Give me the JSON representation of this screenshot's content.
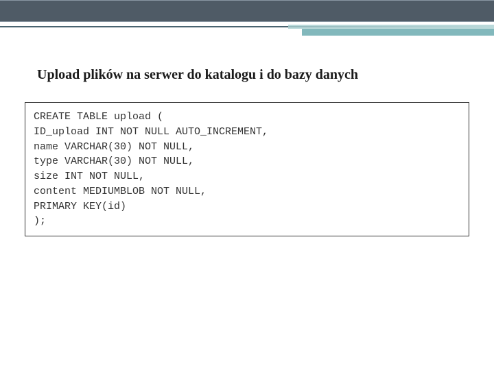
{
  "heading": "Upload plików na serwer do katalogu i do bazy danych",
  "code": "CREATE TABLE upload (\nID_upload INT NOT NULL AUTO_INCREMENT,\nname VARCHAR(30) NOT NULL,\ntype VARCHAR(30) NOT NULL,\nsize INT NOT NULL,\ncontent MEDIUMBLOB NOT NULL,\nPRIMARY KEY(id)\n);"
}
